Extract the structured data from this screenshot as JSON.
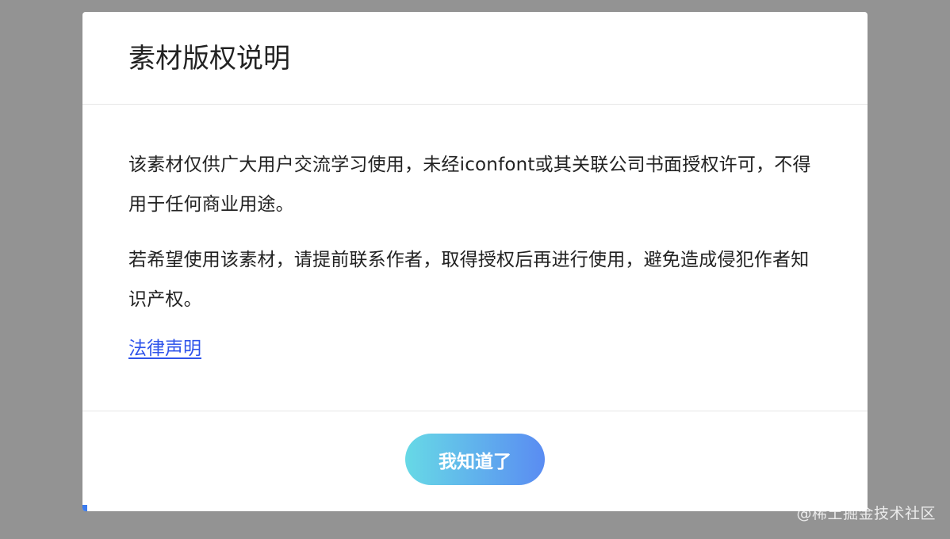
{
  "modal": {
    "title": "素材版权说明",
    "body": {
      "paragraph_1": "该素材仅供广大用户交流学习使用，未经iconfont或其关联公司书面授权许可，不得用于任何商业用途。",
      "paragraph_2": "若希望使用该素材，请提前联系作者，取得授权后再进行使用，避免造成侵犯作者知识产权。",
      "legal_link": "法律声明"
    },
    "footer": {
      "ok_button": "我知道了"
    }
  },
  "watermark": "@稀土掘金技术社区",
  "colors": {
    "overlay": "#939393",
    "link": "#2f54eb",
    "button_gradient_start": "#67d9e6",
    "button_gradient_end": "#5a8cf2"
  }
}
